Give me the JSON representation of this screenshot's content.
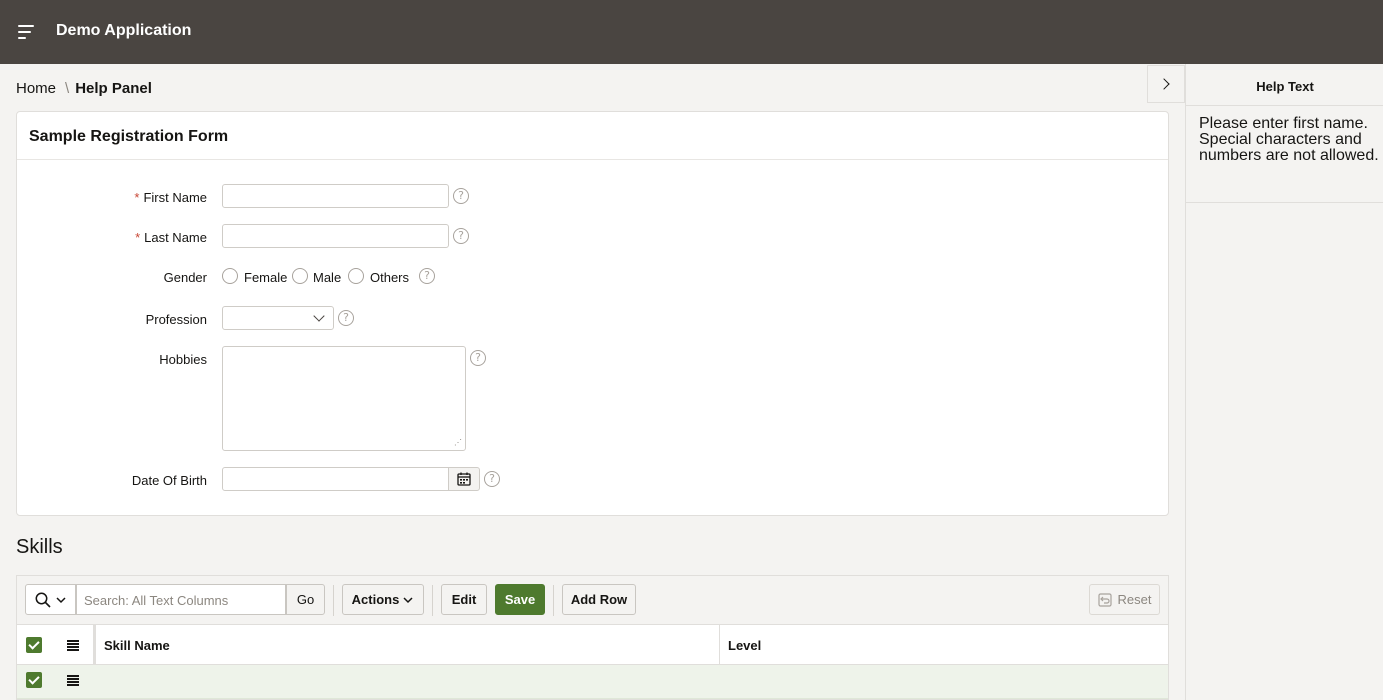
{
  "header": {
    "app_title": "Demo Application"
  },
  "breadcrumb": {
    "home": "Home",
    "separator": "\\",
    "current": "Help Panel"
  },
  "form": {
    "title": "Sample Registration Form",
    "first_name_label": "First Name",
    "last_name_label": "Last Name",
    "required_marker": "*",
    "gender_label": "Gender",
    "gender_options": [
      "Female",
      "Male",
      "Others"
    ],
    "profession_label": "Profession",
    "hobbies_label": "Hobbies",
    "dob_label": "Date Of Birth",
    "help_glyph": "?",
    "first_name_value": "",
    "last_name_value": "",
    "profession_value": "",
    "hobbies_value": "",
    "dob_value": ""
  },
  "skills": {
    "title": "Skills",
    "search_placeholder": "Search: All Text Columns",
    "go_label": "Go",
    "actions_label": "Actions",
    "edit_label": "Edit",
    "save_label": "Save",
    "add_row_label": "Add Row",
    "reset_label": "Reset",
    "columns": [
      "Skill Name",
      "Level"
    ],
    "rows": [
      {
        "skill_name": "",
        "level": ""
      }
    ],
    "save_color": "#4e7a2e"
  },
  "help_panel": {
    "title": "Help Text",
    "text": "Please enter first name. Special characters and numbers are not allowed."
  }
}
